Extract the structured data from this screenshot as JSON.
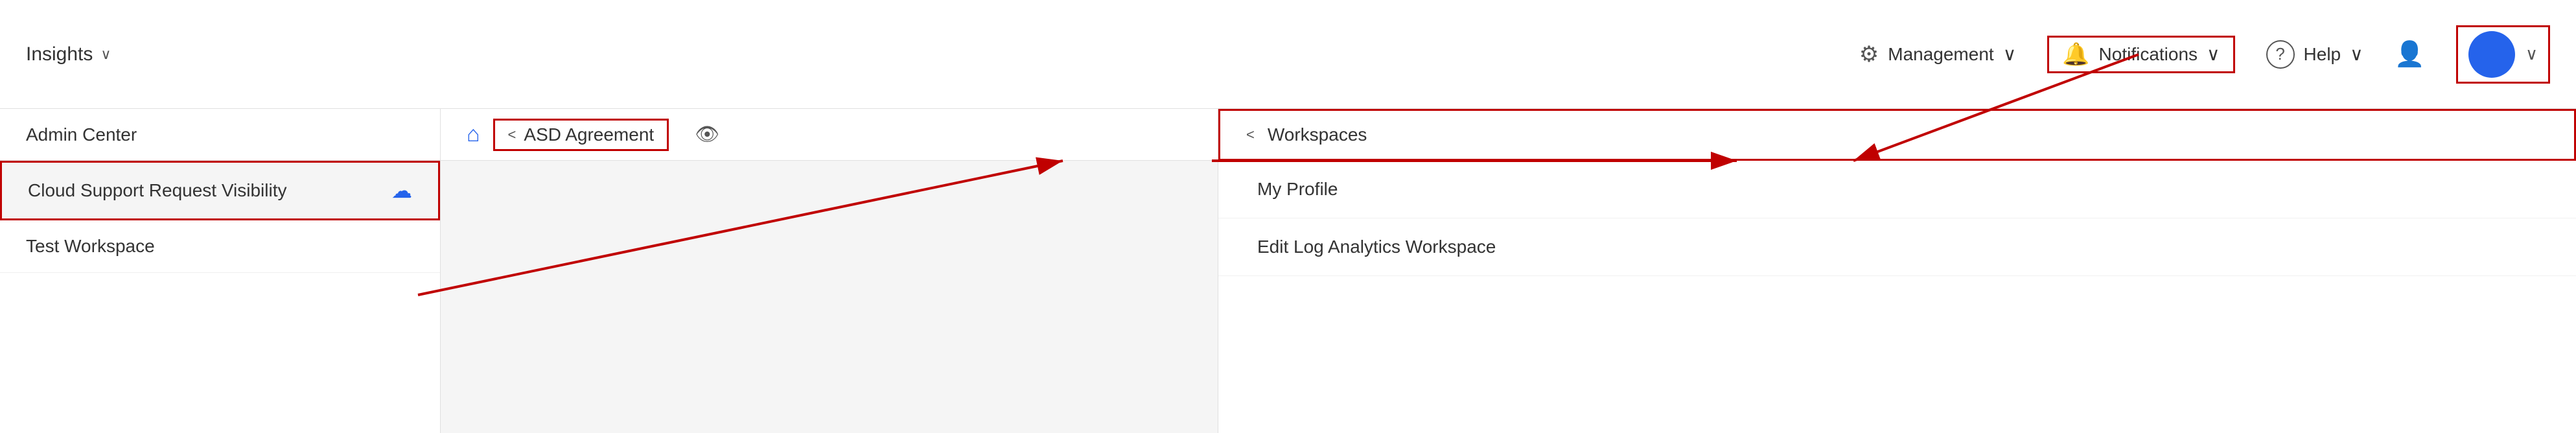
{
  "topbar": {
    "insights_label": "Insights",
    "management_label": "Management",
    "notifications_label": "Notifications",
    "help_label": "Help",
    "chevron": "∨"
  },
  "left_panel": {
    "title": "Admin Center",
    "items": [
      {
        "label": "Cloud Support Request Visibility",
        "icon": "☁",
        "highlighted": true
      },
      {
        "label": "Test Workspace",
        "icon": "",
        "highlighted": false
      }
    ]
  },
  "middle_panel": {
    "nav_label": "ASD Agreement",
    "home_icon": "⌂"
  },
  "right_panel": {
    "nav_label": "Workspaces",
    "items": [
      {
        "label": "My Profile"
      },
      {
        "label": "Edit Log Analytics Workspace"
      }
    ]
  },
  "icons": {
    "gear": "⚙",
    "bell": "🔔",
    "question": "?",
    "person": "👤",
    "home": "⌂",
    "eye": "👁",
    "chevron_left": "<",
    "chevron_down": "∨",
    "cloud": "☁"
  }
}
